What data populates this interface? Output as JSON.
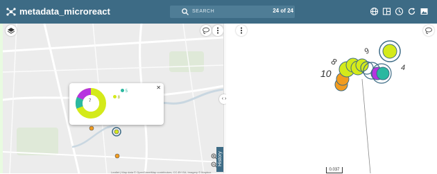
{
  "header": {
    "title": "metadata_microreact",
    "search_placeholder": "SEARCH",
    "count_label": "24 of 24"
  },
  "map": {
    "popup_center_count": "7",
    "popup_legend": [
      {
        "label": "5",
        "color": "#2bb8a0"
      },
      {
        "label": "8",
        "color": "#d4ea1a"
      }
    ],
    "attribution": "Leaflet | Map data © OpenStreetMap contributors, CC-BY-SA, Imagery © Mapbox",
    "history_label": "History",
    "expand_label": "‹ ›"
  },
  "tree": {
    "scale_label": "0.037",
    "leaf_labels": [
      "10",
      "8",
      "9",
      "4"
    ]
  },
  "colors": {
    "header_bg": "#3d6b85",
    "yellow": "#d4ea1a",
    "teal": "#2bb8a0",
    "purple": "#b733e0",
    "orange": "#f29c1f",
    "ring": "#3d6b85"
  }
}
